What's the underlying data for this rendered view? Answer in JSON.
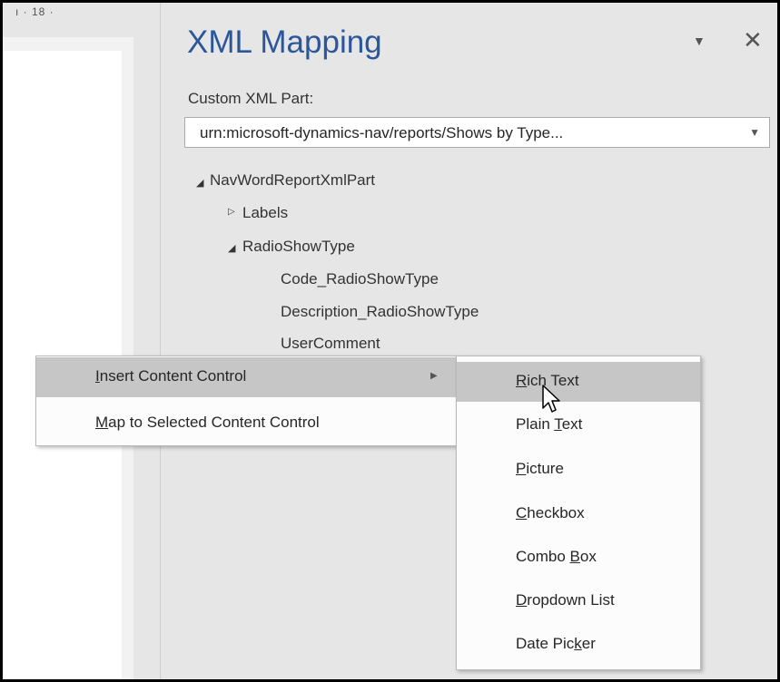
{
  "ruler": {
    "text": "ı · 18 ·"
  },
  "pane": {
    "title": "XML Mapping",
    "custom_xml_part_label": "Custom XML Part:",
    "custom_xml_part_value": "urn:microsoft-dynamics-nav/reports/Shows by Type...",
    "menu_icon": "dropdown-triangle-icon",
    "close_icon": "close-icon"
  },
  "tree": {
    "root": "NavWordReportXmlPart",
    "labels": "Labels",
    "radio_show_type": "RadioShowType",
    "children": [
      "Code_RadioShowType",
      "Description_RadioShowType",
      "UserComment"
    ]
  },
  "context_menu": {
    "items": [
      {
        "pre": "",
        "key": "I",
        "post": "nsert Content Control"
      },
      {
        "pre": "",
        "key": "M",
        "post": "ap to Selected Content Control"
      }
    ]
  },
  "submenu": {
    "items": [
      {
        "pre": "",
        "key": "R",
        "post": "ich Text"
      },
      {
        "pre": "Plain ",
        "key": "T",
        "post": "ext"
      },
      {
        "pre": "",
        "key": "P",
        "post": "icture"
      },
      {
        "pre": "",
        "key": "C",
        "post": "heckbox"
      },
      {
        "pre": "Combo ",
        "key": "B",
        "post": "ox"
      },
      {
        "pre": "",
        "key": "D",
        "post": "ropdown List"
      },
      {
        "pre": "Date Pic",
        "key": "k",
        "post": "er"
      }
    ],
    "highlighted_index": 0
  },
  "colors": {
    "title": "#2b579a",
    "highlight": "#c6c6c6",
    "pane_bg": "#e6e6e6"
  }
}
